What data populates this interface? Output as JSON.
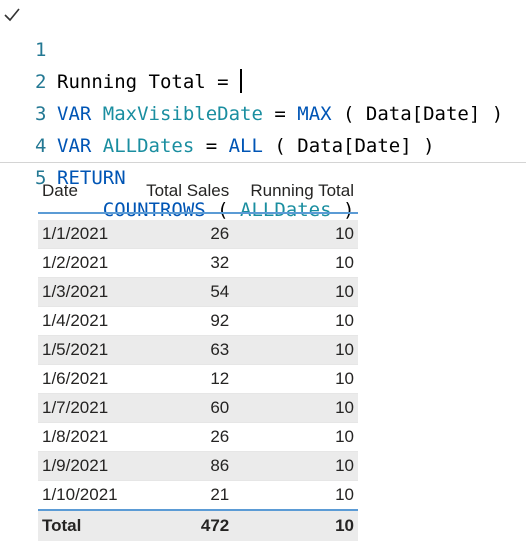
{
  "editor": {
    "lines": [
      {
        "num": "1",
        "text": "Running Total = "
      },
      {
        "num": "2",
        "tokens": [
          {
            "t": "VAR ",
            "c": "kw"
          },
          {
            "t": "MaxVisibleDate",
            "c": "id"
          },
          {
            "t": " = ",
            "c": ""
          },
          {
            "t": "MAX",
            "c": "fn"
          },
          {
            "t": " ( Data[Date] )",
            "c": ""
          }
        ]
      },
      {
        "num": "3",
        "tokens": [
          {
            "t": "VAR ",
            "c": "kw"
          },
          {
            "t": "ALLDates",
            "c": "id"
          },
          {
            "t": " = ",
            "c": ""
          },
          {
            "t": "ALL",
            "c": "fn"
          },
          {
            "t": " ( Data[Date] )",
            "c": ""
          }
        ]
      },
      {
        "num": "4",
        "tokens": [
          {
            "t": "RETURN",
            "c": "kw"
          }
        ]
      },
      {
        "num": "5",
        "tokens": [
          {
            "t": "    ",
            "c": ""
          },
          {
            "t": "COUNTROWS",
            "c": "fn"
          },
          {
            "t": " ( ",
            "c": ""
          },
          {
            "t": "ALLDates",
            "c": "id"
          },
          {
            "t": " )",
            "c": ""
          }
        ]
      }
    ]
  },
  "table": {
    "columns": [
      "Date",
      "Total Sales",
      "Running Total"
    ],
    "rows": [
      [
        "1/1/2021",
        "26",
        "10"
      ],
      [
        "1/2/2021",
        "32",
        "10"
      ],
      [
        "1/3/2021",
        "54",
        "10"
      ],
      [
        "1/4/2021",
        "92",
        "10"
      ],
      [
        "1/5/2021",
        "63",
        "10"
      ],
      [
        "1/6/2021",
        "12",
        "10"
      ],
      [
        "1/7/2021",
        "60",
        "10"
      ],
      [
        "1/8/2021",
        "26",
        "10"
      ],
      [
        "1/9/2021",
        "86",
        "10"
      ],
      [
        "1/10/2021",
        "21",
        "10"
      ]
    ],
    "total": [
      "Total",
      "472",
      "10"
    ]
  },
  "colors": {
    "keyword": "#0055b5",
    "identifier": "#1a8ea0",
    "line_number": "#237893",
    "table_accent": "#5b9bd5"
  }
}
